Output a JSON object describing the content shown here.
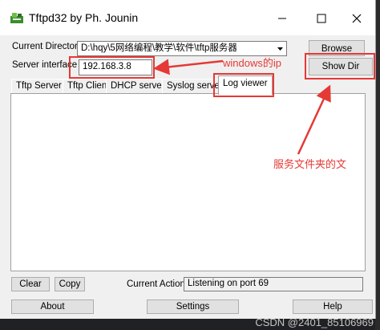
{
  "window": {
    "title": "Tftpd32 by Ph. Jounin"
  },
  "titlebar_buttons": {
    "minimize": "—",
    "maximize": "□",
    "close": "✕"
  },
  "fields": {
    "current_directory_label": "Current Directory",
    "current_directory_value": "D:\\hqy\\5网络编程\\教学\\软件\\tftp服务器",
    "server_interface_label": "Server interface",
    "server_interface_value": "192.168.3.8"
  },
  "buttons": {
    "browse": "Browse",
    "show_dir": "Show Dir"
  },
  "tabs": [
    "Tftp Server",
    "Tftp Client",
    "DHCP server",
    "Syslog server",
    "Log viewer"
  ],
  "active_tab": "Log viewer",
  "annotations": {
    "ip_note": "windows的ip",
    "dir_note": "服务文件夹的文"
  },
  "status": {
    "clear": "Clear",
    "copy": "Copy",
    "current_action_label": "Current Action",
    "current_action_value": "Listening on port 69"
  },
  "bottom": {
    "about": "About",
    "settings": "Settings",
    "help": "Help"
  },
  "watermark": "CSDN @2401_85106969",
  "colors": {
    "annotation_red": "#e53935",
    "window_bg": "#f0f0f0"
  }
}
